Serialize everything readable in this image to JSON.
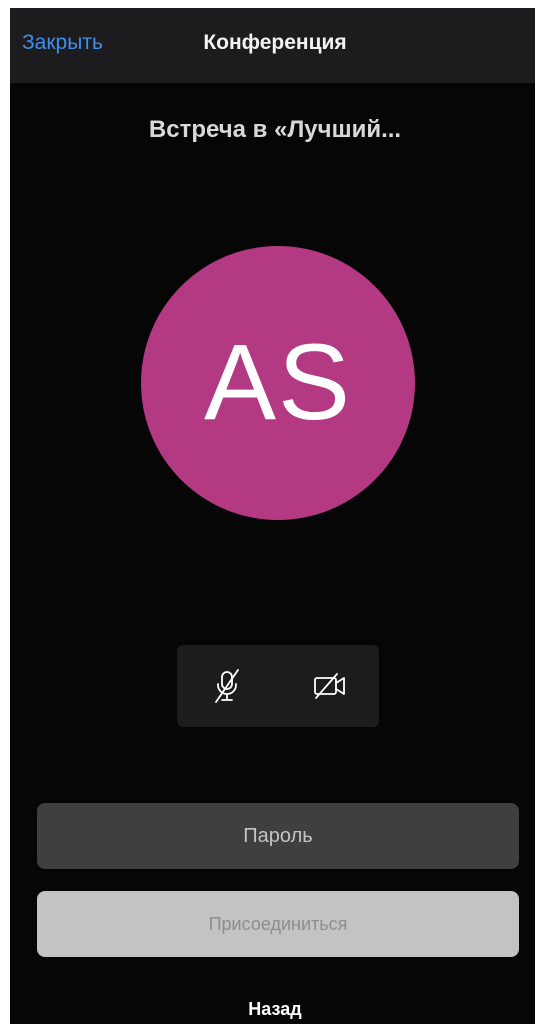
{
  "navbar": {
    "close_label": "Закрыть",
    "title": "Конференция"
  },
  "meeting": {
    "title": "Встреча в «Лучший..."
  },
  "avatar": {
    "initials": "AS",
    "color": "#b23982"
  },
  "controls": {
    "mic_icon": "mic-muted-icon",
    "camera_icon": "camera-off-icon"
  },
  "password": {
    "placeholder": "Пароль",
    "value": ""
  },
  "join": {
    "label": "Присоединиться"
  },
  "back": {
    "label": "Назад"
  }
}
